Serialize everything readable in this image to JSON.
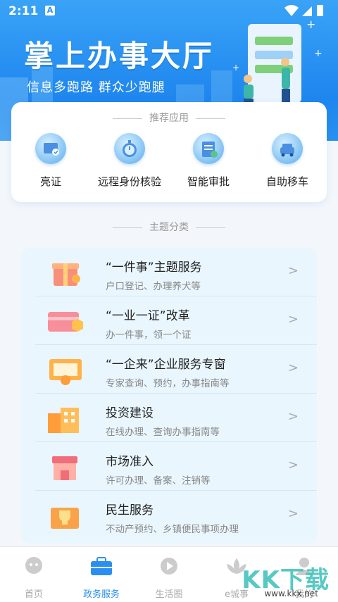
{
  "status_bar": {
    "time": "2:11",
    "a_badge": "A"
  },
  "header": {
    "title": "掌上办事大厅",
    "subtitle": "信息多跑路  群众少跑腿"
  },
  "recommended": {
    "title": "推荐应用",
    "apps": [
      {
        "label": "亮证",
        "icon": "id-card-icon"
      },
      {
        "label": "远程身份核验",
        "icon": "stopwatch-icon"
      },
      {
        "label": "智能审批",
        "icon": "document-check-icon"
      },
      {
        "label": "自助移车",
        "icon": "car-icon"
      }
    ]
  },
  "topics": {
    "title": "主题分类",
    "items": [
      {
        "title": "“一件事”主题服务",
        "subtitle": "户口登记、办理养犬等",
        "icon": "gift-box-icon"
      },
      {
        "title": "“一业一证”改革",
        "subtitle": "办一件事，领一个证",
        "icon": "card-lightning-icon"
      },
      {
        "title": "“一企来”企业服务专窗",
        "subtitle": "专家查询、预约，办事指南等",
        "icon": "certificate-icon"
      },
      {
        "title": "投资建设",
        "subtitle": "在线办理、查询办事指南等",
        "icon": "building-icon"
      },
      {
        "title": "市场准入",
        "subtitle": "许可办理、备案、注销等",
        "icon": "shop-icon"
      },
      {
        "title": "民生服务",
        "subtitle": "不动产预约、乡镇便民事项办理",
        "icon": "trophy-icon"
      }
    ]
  },
  "tabbar": {
    "items": [
      {
        "label": "首页",
        "icon": "home-icon"
      },
      {
        "label": "政务服务",
        "icon": "briefcase-icon"
      },
      {
        "label": "生活圈",
        "icon": "play-icon"
      },
      {
        "label": "e城事",
        "icon": "lotus-icon"
      },
      {
        "label": "我的",
        "icon": "user-icon"
      }
    ],
    "active": "政务服务"
  },
  "watermark": {
    "text": "KK下载",
    "url": "www.kkx.net"
  },
  "colors": {
    "primary": "#2a8ff0",
    "list_bg": "#e9f6fe"
  }
}
